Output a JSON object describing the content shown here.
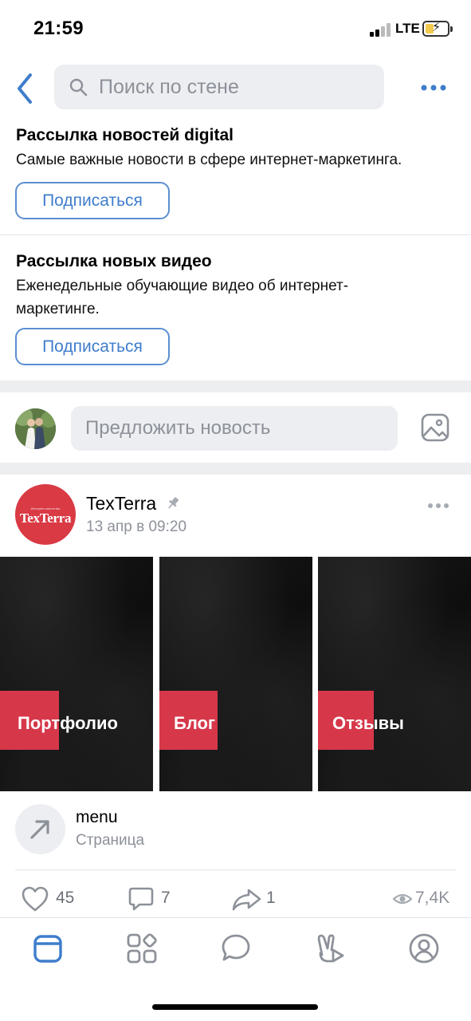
{
  "status_bar": {
    "time": "21:59",
    "network": "LTE"
  },
  "header": {
    "search_placeholder": "Поиск по стене"
  },
  "newsletters": [
    {
      "title": "Рассылка новостей digital",
      "description": "Самые важные новости в сфере интернет-маркетинга.",
      "button_label": "Подписаться"
    },
    {
      "title": "Рассылка новых видео",
      "description": "Еженедельные обучающие видео об интернет-маркетинге.",
      "button_label": "Подписаться"
    }
  ],
  "suggest": {
    "placeholder": "Предложить новость"
  },
  "post": {
    "author": "TexTerra",
    "avatar_logo": "TexTerra",
    "avatar_small_text": "Интернет-агентство",
    "date": "13 апр в 09:20",
    "gallery": [
      {
        "label": "Портфолио"
      },
      {
        "label": "Блог"
      },
      {
        "label": "Отзывы"
      }
    ],
    "link": {
      "title": "menu",
      "subtitle": "Страница"
    },
    "likes": "45",
    "comments": "7",
    "shares": "1",
    "views": "7,4K"
  },
  "tabbar": {
    "items": [
      {
        "icon": "news-feed-icon",
        "active": true
      },
      {
        "icon": "services-grid-icon",
        "active": false
      },
      {
        "icon": "messages-icon",
        "active": false
      },
      {
        "icon": "clips-icon",
        "active": false
      },
      {
        "icon": "profile-icon",
        "active": false
      }
    ]
  },
  "colors": {
    "accent": "#3f7dcc",
    "brand_red": "#d6384a",
    "secondary_text": "#8d9199"
  }
}
